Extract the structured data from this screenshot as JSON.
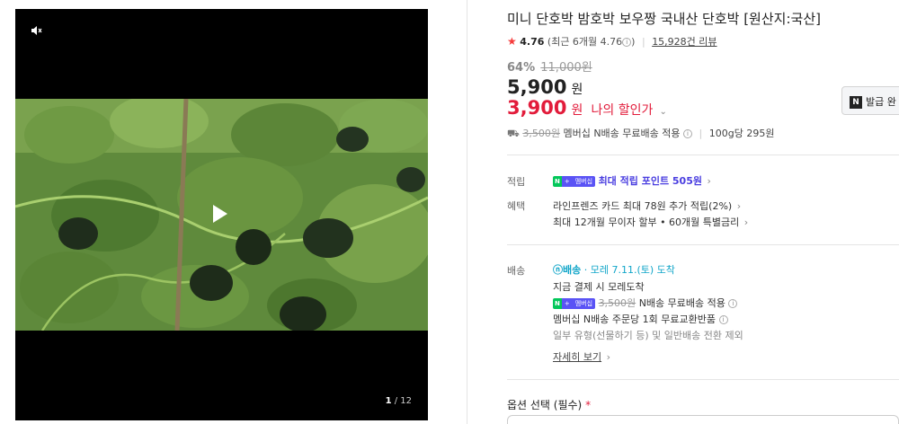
{
  "media": {
    "mute_icon": "speaker-muted",
    "counter_current": "1",
    "counter_total": "/ 12",
    "play_icon": "play"
  },
  "product": {
    "title": "미니 단호박 밤호박 보우짱 국내산 단호박 [원산지:국산]",
    "rating_score": "4.76",
    "rating_recent": "(최근 6개월 4.76",
    "reviews": "15,928건 리뷰",
    "discount_pct": "64%",
    "original_price": "11,000원",
    "price": "5,900",
    "price_unit": "원",
    "my_price": "3,900",
    "my_price_unit": "원",
    "my_price_label": "나의 할인가",
    "coupon_label": "발급 완",
    "shipping_strike": "3,500원",
    "shipping_text": "멤버십 N배송 무료배송 적용",
    "unit_price": "100g당 295원"
  },
  "benefits": {
    "points_label": "적립",
    "points_text": "최대 적립 포인트 505원",
    "perks_label": "혜택",
    "perk1": "라인프렌즈 카드 최대 78원 추가 적립(2%)",
    "perk2": "최대 12개월 무이자 할부 • 60개월 특별금리",
    "membership_badge": "멤버십"
  },
  "delivery": {
    "label": "배송",
    "badge": "배송",
    "when": "· 모레 7.11.(토) 도착",
    "line1": "지금 결제 시 모레도착",
    "line2_strike": "3,500원",
    "line2": "N배송 무료배송 적용",
    "line3": "멤버십 N배송 주문당 1회 무료교환반품",
    "line4": "일부 유형(선물하기 등) 및 일반배송 전환 제외",
    "more": "자세히 보기"
  },
  "options": {
    "label": "옵션 선택 (필수)",
    "required_mark": "*"
  },
  "colors": {
    "accent_red": "#e21c3b",
    "points_purple": "#4a3ee0",
    "delivery_teal": "#12a6c9",
    "naver_green": "#03c75a"
  }
}
